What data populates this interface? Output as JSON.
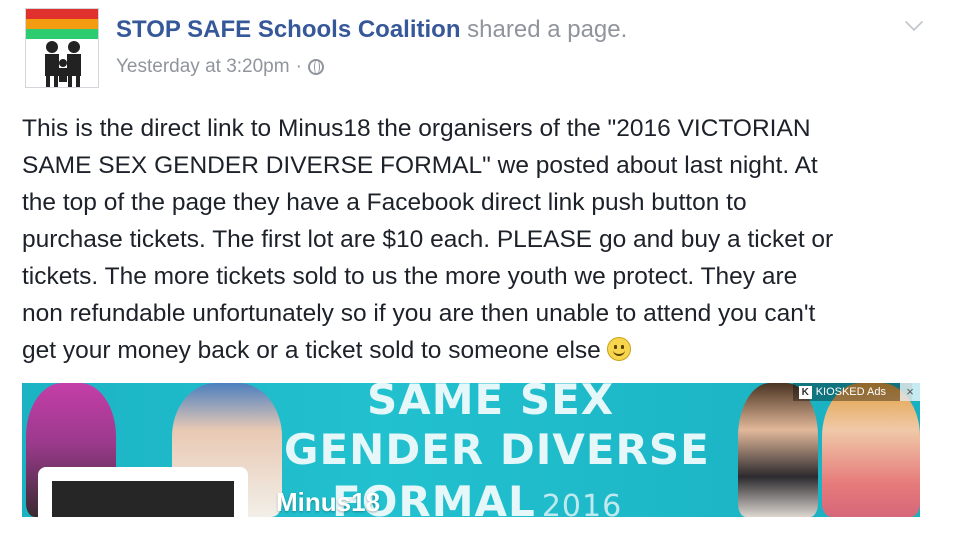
{
  "post": {
    "page_name": "STOP SAFE Schools Coalition",
    "action_text": " shared a page.",
    "timestamp": "Yesterday at 3:20pm",
    "separator": "·",
    "privacy_icon": "globe-icon",
    "menu_icon": "chevron-down-icon",
    "body_lines": [
      "This is the direct link to Minus18 the organisers of the \"2016 VICTORIAN",
      "SAME SEX GENDER DIVERSE FORMAL\" we posted about last night. At",
      "the top of the page they have a Facebook direct link push button to",
      "purchase tickets. The first lot are $10 each. PLEASE go and buy a ticket or",
      "tickets. The more tickets sold to us the more youth we protect. They are",
      "non refundable unfortunately so if you are then unable to attend you can't",
      "get your money back or a ticket sold to someone else"
    ],
    "emoji": "smiley-icon"
  },
  "banner": {
    "title_line1": "SAME SEX",
    "title_line2": "GENDER DIVERSE",
    "title_line3": "FORMAL",
    "year": "2016",
    "brand_name": "Minus18",
    "ad_label": "KIOSKED Ads",
    "ad_logo_letter": "K",
    "close_glyph": "×"
  },
  "colors": {
    "page_name": "#365899",
    "meta_text": "#90949c",
    "body_text": "#1d2129",
    "banner_bg": "#1bb3c4"
  }
}
